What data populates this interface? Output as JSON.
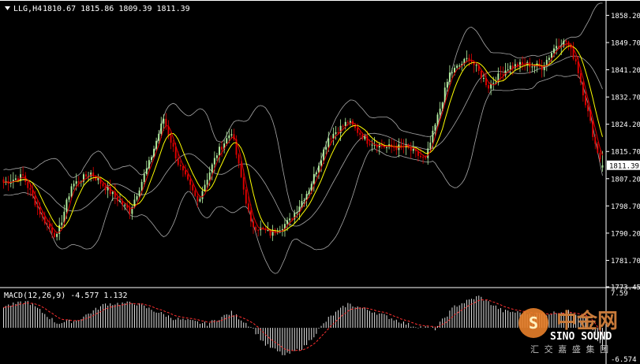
{
  "window": {
    "symbol_label": "LLG,H4",
    "ohlc_label": "1810.67 1815.86 1809.39 1811.39"
  },
  "chart_data": [
    {
      "type": "candlestick",
      "title": "LLG,H4",
      "ohlc_text": "1810.67 1815.86 1809.39 1811.39",
      "last_price": 1811.39,
      "ylim": [
        1773.45,
        1862.0
      ],
      "ticks": [
        1858.2,
        1849.7,
        1841.2,
        1832.7,
        1824.2,
        1815.7,
        1807.2,
        1798.7,
        1790.2,
        1781.7,
        1773.45
      ],
      "tick_labels": [
        "1858.20",
        "1849.70",
        "1841.20",
        "1832.70",
        "1824.20",
        "1815.70",
        "1807.20",
        "1798.70",
        "1790.20",
        "1781.70",
        "1773.45"
      ],
      "colors": {
        "bull": "#b4f0a0",
        "bear": "#e00000",
        "ma": "#ffff00",
        "bands": "#a8a8a8",
        "background": "#000000",
        "grid": "#ffffff"
      },
      "anchors": [
        [
          0,
          1806
        ],
        [
          8,
          1808
        ],
        [
          16,
          1795
        ],
        [
          22,
          1789
        ],
        [
          28,
          1805
        ],
        [
          36,
          1809
        ],
        [
          44,
          1803
        ],
        [
          52,
          1797
        ],
        [
          60,
          1812
        ],
        [
          66,
          1826
        ],
        [
          72,
          1812
        ],
        [
          80,
          1800
        ],
        [
          88,
          1815
        ],
        [
          94,
          1822
        ],
        [
          102,
          1793
        ],
        [
          110,
          1790
        ],
        [
          118,
          1794
        ],
        [
          126,
          1804
        ],
        [
          134,
          1820
        ],
        [
          142,
          1825
        ],
        [
          150,
          1819
        ],
        [
          158,
          1817
        ],
        [
          166,
          1817
        ],
        [
          174,
          1813
        ],
        [
          184,
          1840
        ],
        [
          192,
          1845
        ],
        [
          200,
          1836
        ],
        [
          208,
          1842
        ],
        [
          215,
          1843
        ],
        [
          222,
          1842
        ],
        [
          228,
          1849
        ],
        [
          232,
          1850
        ],
        [
          236,
          1844
        ],
        [
          240,
          1831
        ],
        [
          244,
          1818
        ],
        [
          247,
          1811.39
        ]
      ]
    },
    {
      "type": "macd",
      "label": "MACD(12,26,9) -4.577 1.132",
      "ylim": [
        -6.574,
        7.59
      ],
      "tick_labels": [
        "7.59",
        "-6.574"
      ],
      "anchors": [
        [
          0,
          4.5
        ],
        [
          10,
          5.5
        ],
        [
          22,
          1.0
        ],
        [
          30,
          1.5
        ],
        [
          42,
          5.0
        ],
        [
          54,
          5.2
        ],
        [
          70,
          2.0
        ],
        [
          84,
          0.8
        ],
        [
          94,
          3.2
        ],
        [
          102,
          0.3
        ],
        [
          108,
          -3.5
        ],
        [
          116,
          -5.8
        ],
        [
          124,
          -4.0
        ],
        [
          134,
          2.0
        ],
        [
          142,
          5.0
        ],
        [
          152,
          3.5
        ],
        [
          168,
          0.5
        ],
        [
          178,
          -0.2
        ],
        [
          186,
          4.5
        ],
        [
          196,
          6.6
        ],
        [
          206,
          3.5
        ],
        [
          222,
          2.8
        ],
        [
          232,
          3.5
        ],
        [
          240,
          2.5
        ],
        [
          247,
          -4.577
        ]
      ]
    }
  ],
  "watermark": {
    "cn_title": "中金网",
    "en_title": "SINO SOUND",
    "cn_subtitle": "汇 交 嘉 盛 集 团"
  }
}
